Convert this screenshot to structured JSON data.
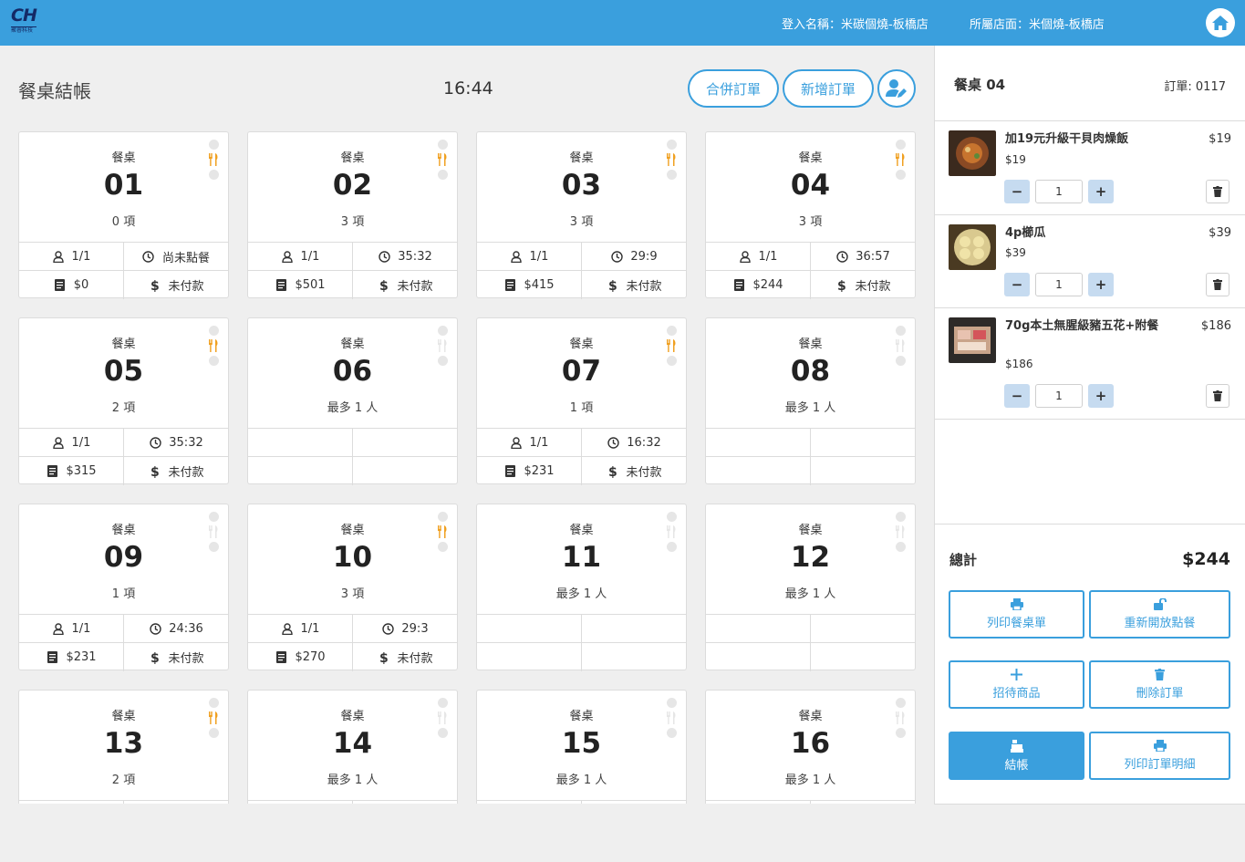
{
  "topbar": {
    "logo_text": "CH",
    "logo_sub": "聚睿科技",
    "user": "登入名稱：米碳個燒-板橋店",
    "store": "所屬店面：米個燒-板橋店"
  },
  "header": {
    "title": "餐桌結帳",
    "time": "16:44",
    "merge_label": "合併訂單",
    "new_label": "新增訂單"
  },
  "tables": [
    {
      "label": "餐桌",
      "number": "01",
      "sub": "0 項",
      "active": true,
      "guests": "1/1",
      "time": "尚未點餐",
      "amount": "$0",
      "pay": "未付款"
    },
    {
      "label": "餐桌",
      "number": "02",
      "sub": "3 項",
      "active": true,
      "guests": "1/1",
      "time": "35:32",
      "amount": "$501",
      "pay": "未付款"
    },
    {
      "label": "餐桌",
      "number": "03",
      "sub": "3 項",
      "active": true,
      "guests": "1/1",
      "time": "29:9",
      "amount": "$415",
      "pay": "未付款"
    },
    {
      "label": "餐桌",
      "number": "04",
      "sub": "3 項",
      "active": true,
      "guests": "1/1",
      "time": "36:57",
      "amount": "$244",
      "pay": "未付款"
    },
    {
      "label": "餐桌",
      "number": "05",
      "sub": "2 項",
      "active": true,
      "guests": "1/1",
      "time": "35:32",
      "amount": "$315",
      "pay": "未付款"
    },
    {
      "label": "餐桌",
      "number": "06",
      "sub": "最多 1 人",
      "active": false,
      "guests": "",
      "time": "",
      "amount": "",
      "pay": ""
    },
    {
      "label": "餐桌",
      "number": "07",
      "sub": "1 項",
      "active": true,
      "guests": "1/1",
      "time": "16:32",
      "amount": "$231",
      "pay": "未付款"
    },
    {
      "label": "餐桌",
      "number": "08",
      "sub": "最多 1 人",
      "active": false,
      "guests": "",
      "time": "",
      "amount": "",
      "pay": ""
    },
    {
      "label": "餐桌",
      "number": "09",
      "sub": "1 項",
      "active": false,
      "guests": "1/1",
      "time": "24:36",
      "amount": "$231",
      "pay": "未付款"
    },
    {
      "label": "餐桌",
      "number": "10",
      "sub": "3 項",
      "active": true,
      "guests": "1/1",
      "time": "29:3",
      "amount": "$270",
      "pay": "未付款"
    },
    {
      "label": "餐桌",
      "number": "11",
      "sub": "最多 1 人",
      "active": false,
      "guests": "",
      "time": "",
      "amount": "",
      "pay": ""
    },
    {
      "label": "餐桌",
      "number": "12",
      "sub": "最多 1 人",
      "active": false,
      "guests": "",
      "time": "",
      "amount": "",
      "pay": ""
    },
    {
      "label": "餐桌",
      "number": "13",
      "sub": "2 項",
      "active": true,
      "guests": "",
      "time": "",
      "amount": "",
      "pay": ""
    },
    {
      "label": "餐桌",
      "number": "14",
      "sub": "最多 1 人",
      "active": false,
      "guests": "",
      "time": "",
      "amount": "",
      "pay": ""
    },
    {
      "label": "餐桌",
      "number": "15",
      "sub": "最多 1 人",
      "active": false,
      "guests": "",
      "time": "",
      "amount": "",
      "pay": ""
    },
    {
      "label": "餐桌",
      "number": "16",
      "sub": "最多 1 人",
      "active": false,
      "guests": "",
      "time": "",
      "amount": "",
      "pay": ""
    }
  ],
  "order": {
    "table": "餐桌 04",
    "order_no": "訂單: 0117",
    "items": [
      {
        "name": "加19元升級干貝肉燥飯",
        "price_right": "$19",
        "price": "$19",
        "qty": "1"
      },
      {
        "name": "4p櫛瓜",
        "price_right": "$39",
        "price": "$39",
        "qty": "1"
      },
      {
        "name": "70g本土無腥級豬五花+附餐",
        "price_right": "$186",
        "price": "$186",
        "qty": "1"
      }
    ],
    "total_label": "總計",
    "total": "$244",
    "actions": {
      "print_table": "列印餐桌單",
      "reopen": "重新開放點餐",
      "comp": "招待商品",
      "delete": "刪除訂單",
      "checkout": "結帳",
      "print_detail": "列印訂單明細"
    }
  },
  "colors": {
    "accent": "#3a9fdd",
    "fork_active": "#f0a020",
    "fork_inactive": "#e6e6e6"
  }
}
